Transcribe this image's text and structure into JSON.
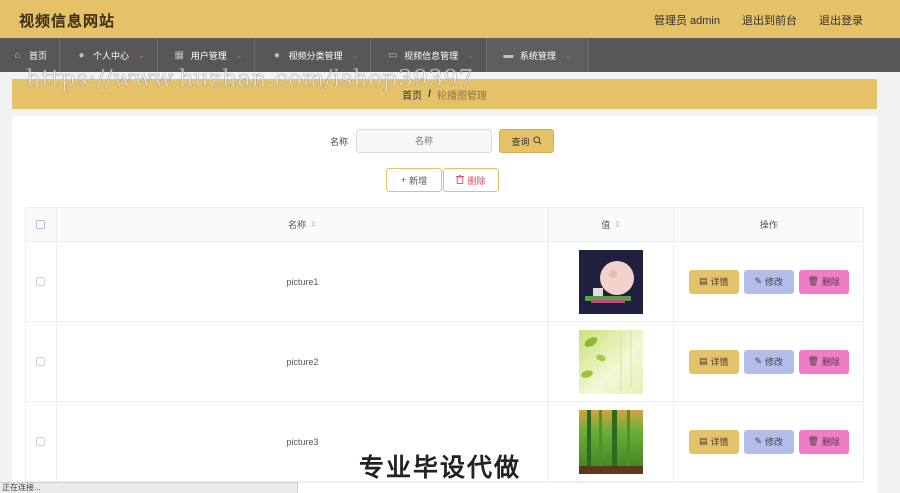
{
  "header": {
    "site_title": "视频信息网站",
    "links": [
      "管理员 admin",
      "退出到前台",
      "退出登录"
    ]
  },
  "nav": {
    "items": [
      {
        "label": "首页",
        "icon": "home-icon",
        "has_dropdown": false
      },
      {
        "label": "个人中心",
        "icon": "user-icon",
        "has_dropdown": true
      },
      {
        "label": "用户管理",
        "icon": "grid-icon",
        "has_dropdown": true
      },
      {
        "label": "视频分类管理",
        "icon": "location-icon",
        "has_dropdown": true
      },
      {
        "label": "视频信息管理",
        "icon": "message-icon",
        "has_dropdown": true
      },
      {
        "label": "系统管理",
        "icon": "briefcase-icon",
        "has_dropdown": true
      }
    ]
  },
  "breadcrumb": {
    "home": "首页",
    "separator": "/",
    "current": "轮播图管理"
  },
  "search": {
    "label": "名称",
    "placeholder": "名称",
    "value": "",
    "button_label": "查询"
  },
  "actions": {
    "add_label": "新增",
    "delete_label": "删除"
  },
  "table": {
    "columns": [
      "名称",
      "值",
      "操作"
    ],
    "rows": [
      {
        "name": "picture1",
        "image": "moon-thumbnail"
      },
      {
        "name": "picture2",
        "image": "leaves-thumbnail"
      },
      {
        "name": "picture3",
        "image": "forest-thumbnail"
      }
    ],
    "row_actions": {
      "detail": "详情",
      "edit": "修改",
      "delete": "删除"
    }
  },
  "status_bar": "正在连接...",
  "watermarks": {
    "url": "https://www.huzhan.com/ishop39397",
    "slogan": "专业毕设代做"
  },
  "colors": {
    "accent": "#e5c168",
    "nav_bg": "#575757",
    "edit": "#b3bde8",
    "delete": "#f07cc5",
    "danger_text": "#e84b5f"
  }
}
